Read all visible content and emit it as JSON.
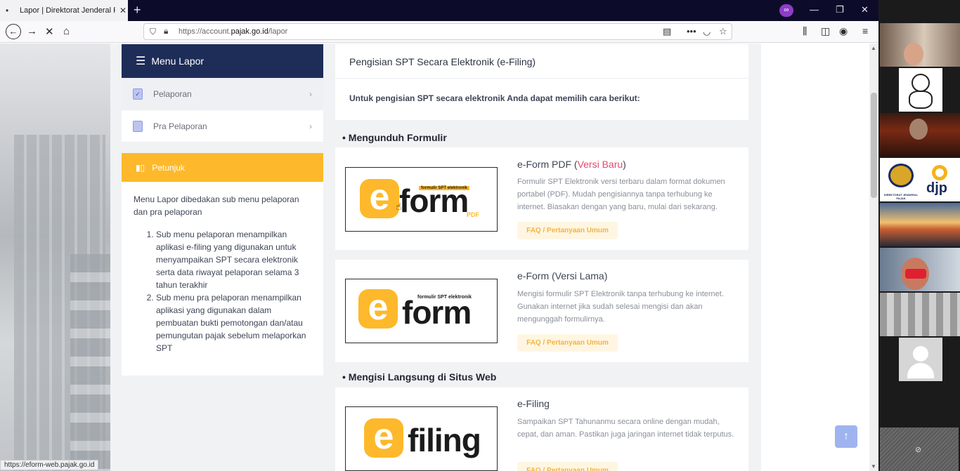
{
  "browser": {
    "tab_title": "Lapor | Direktorat Jenderal Pajak",
    "url_prefix": "https://account.",
    "url_domain": "pajak.go.id",
    "url_path": "/lapor",
    "status_url": "https://eform-web.pajak.go.id"
  },
  "sidebar": {
    "menu_title": "Menu Lapor",
    "items": [
      {
        "label": "Pelaporan"
      },
      {
        "label": "Pra Pelaporan"
      }
    ],
    "petunjuk_title": "Petunjuk",
    "petunjuk_intro": "Menu Lapor dibedakan sub menu pelaporan dan pra pelaporan",
    "petunjuk_list": [
      "Sub menu pelaporan menampilkan aplikasi e-filing yang digunakan untuk menyampaikan SPT secara elektronik serta data riwayat pelaporan selama 3 tahun terakhir",
      "Sub menu pra pelaporan menampilkan aplikasi yang digunakan dalam pembuatan bukti pemotongan dan/atau pemungutan pajak sebelum melaporkan SPT"
    ]
  },
  "main": {
    "header_title": "Pengisian SPT Secara Elektronik (e-Filing)",
    "header_text": "Untuk pengisian SPT secara elektronik Anda dapat memilih cara berikut:",
    "section1": "• Mengunduh Formulir",
    "section2": "• Mengisi Langsung di Situs Web",
    "items": [
      {
        "title_main": "e-Form PDF (",
        "title_red": "Versi Baru",
        "title_end": ")",
        "desc": "Formulir SPT Elektronik versi terbaru dalam format dokumen portabel (PDF). Mudah pengisiannya tanpa terhubung ke internet. Biasakan dengan yang baru, mulai dari sekarang.",
        "faq": "FAQ / Pertanyaan Umum",
        "logo_letter": "e",
        "logo_word": "form",
        "logo_tag": "formulir SPT elektronik",
        "logo_sub": "PDF"
      },
      {
        "title": "e-Form (Versi Lama)",
        "desc": "Mengisi formulir SPT Elektronik tanpa terhubung ke internet. Gunakan internet jika sudah selesai mengisi dan akan mengunggah formulirnya.",
        "faq": "FAQ / Pertanyaan Umum",
        "logo_letter": "e",
        "logo_word": "form",
        "logo_tag": "formulir SPT elektronik"
      },
      {
        "title": "e-Filing",
        "desc": "Sampaikan SPT Tahunanmu secara online dengan mudah, cepat, dan aman. Pastikan juga jaringan internet tidak terputus.",
        "faq": "FAQ / Pertanyaan Umum",
        "logo_letter": "e",
        "logo_word": "filing"
      }
    ]
  },
  "video_panel": {
    "djp_text": "djp",
    "djp_caption": "DIREKTORAT JENDERAL PAJAK"
  },
  "colors": {
    "navy": "#1e2d58",
    "amber": "#fdb92b",
    "accent_red": "#e8466d"
  }
}
